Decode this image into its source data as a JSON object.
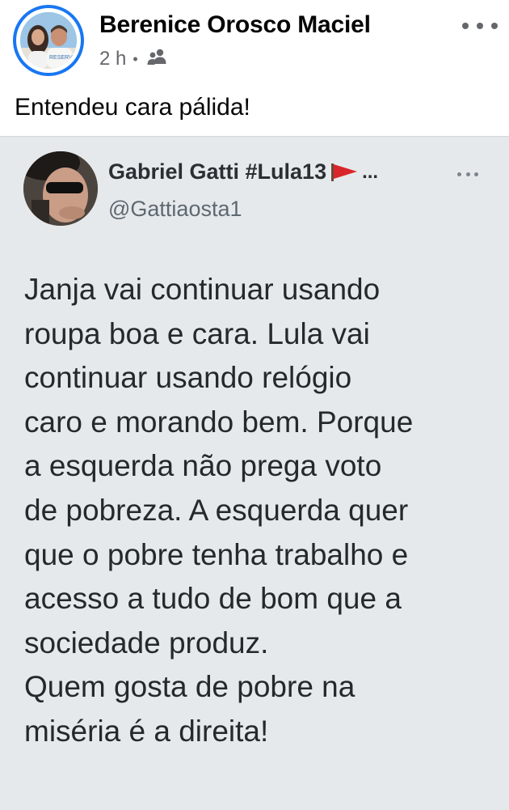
{
  "post": {
    "author_name": "Berenice Orosco Maciel",
    "timestamp": "2 h",
    "separator": "•",
    "audience_icon": "friends-icon",
    "more_icon": "more-horizontal-icon",
    "caption": "Entendeu cara pálida!"
  },
  "tweet": {
    "display_name": "Gabriel Gatti #Lula13",
    "flag_icon": "red-flag-icon",
    "name_truncation": "...",
    "handle": "@Gattiaosta1",
    "more_icon": "more-horizontal-icon",
    "text_lines": [
      "Janja vai continuar usando",
      "roupa boa e cara. Lula vai",
      "continuar usando relógio",
      "caro e morando bem. Porque",
      "a esquerda não prega voto",
      "de pobreza. A esquerda quer",
      "que o pobre tenha trabalho e",
      "acesso a tudo de bom que a",
      "sociedade produz.",
      "Quem gosta de pobre na",
      "miséria é a direita!"
    ]
  },
  "colors": {
    "brand_blue": "#1877f2",
    "tweet_background": "#e6e9ec",
    "flag_red": "#d9262b"
  }
}
